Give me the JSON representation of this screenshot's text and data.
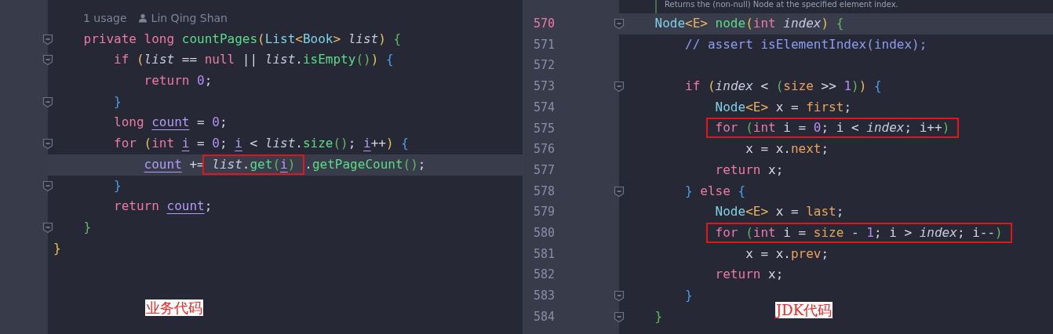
{
  "left": {
    "hint": {
      "usages": "1 usage",
      "author": "Lin Qing Shan"
    },
    "lines": [
      {
        "fold": true,
        "current": false,
        "tokens": [
          {
            "kind": "kw",
            "text": "    private "
          },
          {
            "kind": "kw",
            "text": "long "
          },
          {
            "kind": "fn",
            "text": "countPages"
          },
          {
            "kind": "b1",
            "text": "("
          },
          {
            "kind": "type",
            "text": "List"
          },
          {
            "kind": "gen",
            "text": "<"
          },
          {
            "kind": "type",
            "text": "Book"
          },
          {
            "kind": "gen",
            "text": "> "
          },
          {
            "kind": "param",
            "text": "list"
          },
          {
            "kind": "b1",
            "text": ") "
          },
          {
            "kind": "b2",
            "text": "{"
          }
        ]
      },
      {
        "fold": true,
        "current": false,
        "tokens": [
          {
            "kind": "kw",
            "text": "        if "
          },
          {
            "kind": "b1",
            "text": "("
          },
          {
            "kind": "param",
            "text": "list"
          },
          {
            "kind": "plain",
            "text": " == "
          },
          {
            "kind": "kw",
            "text": "null"
          },
          {
            "kind": "plain",
            "text": " || "
          },
          {
            "kind": "param",
            "text": "list"
          },
          {
            "kind": "plain",
            "text": "."
          },
          {
            "kind": "fn",
            "text": "isEmpty"
          },
          {
            "kind": "b2",
            "text": "()"
          },
          {
            "kind": "b1",
            "text": ") "
          },
          {
            "kind": "b3",
            "text": "{"
          }
        ]
      },
      {
        "fold": false,
        "current": false,
        "tokens": [
          {
            "kind": "kw",
            "text": "            return "
          },
          {
            "kind": "num",
            "text": "0"
          },
          {
            "kind": "plain",
            "text": ";"
          }
        ]
      },
      {
        "fold": true,
        "current": false,
        "tokens": [
          {
            "kind": "b3",
            "text": "        }"
          }
        ]
      },
      {
        "fold": false,
        "current": false,
        "tokens": [
          {
            "kind": "kw",
            "text": "        long "
          },
          {
            "kind": "local",
            "text": "count"
          },
          {
            "kind": "plain",
            "text": " = "
          },
          {
            "kind": "num",
            "text": "0"
          },
          {
            "kind": "plain",
            "text": ";"
          }
        ]
      },
      {
        "fold": true,
        "current": false,
        "tokens": [
          {
            "kind": "kw",
            "text": "        for "
          },
          {
            "kind": "b1",
            "text": "("
          },
          {
            "kind": "kw",
            "text": "int "
          },
          {
            "kind": "local",
            "text": "i"
          },
          {
            "kind": "plain",
            "text": " = "
          },
          {
            "kind": "num",
            "text": "0"
          },
          {
            "kind": "plain",
            "text": "; "
          },
          {
            "kind": "local",
            "text": "i"
          },
          {
            "kind": "plain",
            "text": " < "
          },
          {
            "kind": "param",
            "text": "list"
          },
          {
            "kind": "plain",
            "text": "."
          },
          {
            "kind": "fn",
            "text": "size"
          },
          {
            "kind": "b2",
            "text": "()"
          },
          {
            "kind": "plain",
            "text": "; "
          },
          {
            "kind": "local",
            "text": "i"
          },
          {
            "kind": "plain",
            "text": "++"
          },
          {
            "kind": "b1",
            "text": ") "
          },
          {
            "kind": "b3",
            "text": "{"
          }
        ]
      },
      {
        "fold": false,
        "current": true,
        "tokens": [
          {
            "kind": "local",
            "text": "            count"
          },
          {
            "kind": "plain",
            "text": " += "
          },
          {
            "kind": "box",
            "tokens": [
              {
                "kind": "param",
                "text": "list"
              },
              {
                "kind": "plain",
                "text": "."
              },
              {
                "kind": "fn",
                "text": "get"
              },
              {
                "kind": "b2",
                "text": "("
              },
              {
                "kind": "local",
                "text": "i"
              },
              {
                "kind": "b2",
                "text": ")"
              }
            ]
          },
          {
            "kind": "plain",
            "text": "."
          },
          {
            "kind": "fn",
            "text": "getPageCount"
          },
          {
            "kind": "b2",
            "text": "()"
          },
          {
            "kind": "plain",
            "text": ";"
          }
        ]
      },
      {
        "fold": true,
        "current": false,
        "tokens": [
          {
            "kind": "b3",
            "text": "        }"
          }
        ]
      },
      {
        "fold": false,
        "current": false,
        "tokens": [
          {
            "kind": "kw",
            "text": "        return "
          },
          {
            "kind": "local",
            "text": "count"
          },
          {
            "kind": "plain",
            "text": ";"
          }
        ]
      },
      {
        "fold": true,
        "current": false,
        "tokens": [
          {
            "kind": "b2",
            "text": "    }"
          }
        ]
      },
      {
        "fold": false,
        "current": false,
        "tokens": [
          {
            "kind": "b1",
            "text": "}"
          }
        ]
      }
    ],
    "annotation": "业务代码"
  },
  "right": {
    "doc": "Returns the (non-null) Node at the specified element index.",
    "lines": [
      {
        "number": "570",
        "fold": true,
        "current": true,
        "tokens": [
          {
            "kind": "type",
            "text": "    Node"
          },
          {
            "kind": "gen",
            "text": "<E> "
          },
          {
            "kind": "fn",
            "text": "node"
          },
          {
            "kind": "b1",
            "text": "("
          },
          {
            "kind": "kw",
            "text": "int "
          },
          {
            "kind": "param",
            "text": "index"
          },
          {
            "kind": "b1",
            "text": ") "
          },
          {
            "kind": "b2",
            "text": "{"
          }
        ]
      },
      {
        "number": "571",
        "fold": false,
        "current": false,
        "tokens": [
          {
            "kind": "comment",
            "text": "        // assert isElementIndex(index);"
          }
        ]
      },
      {
        "number": "572",
        "fold": false,
        "current": false
      },
      {
        "number": "573",
        "fold": true,
        "current": false,
        "tokens": [
          {
            "kind": "kw",
            "text": "        if "
          },
          {
            "kind": "b1",
            "text": "("
          },
          {
            "kind": "param",
            "text": "index"
          },
          {
            "kind": "plain",
            "text": " < "
          },
          {
            "kind": "b2",
            "text": "("
          },
          {
            "kind": "field",
            "text": "size"
          },
          {
            "kind": "plain",
            "text": " >> "
          },
          {
            "kind": "num",
            "text": "1"
          },
          {
            "kind": "b2",
            "text": ")"
          },
          {
            "kind": "b1",
            "text": ") "
          },
          {
            "kind": "b3",
            "text": "{"
          }
        ]
      },
      {
        "number": "574",
        "fold": false,
        "current": false,
        "tokens": [
          {
            "kind": "type",
            "text": "            Node"
          },
          {
            "kind": "gen",
            "text": "<E>"
          },
          {
            "kind": "plain",
            "text": " x = "
          },
          {
            "kind": "field",
            "text": "first"
          },
          {
            "kind": "plain",
            "text": ";"
          }
        ]
      },
      {
        "number": "575",
        "fold": false,
        "current": false,
        "tokens": [
          {
            "kind": "box",
            "tokens": [
              {
                "kind": "kw",
                "text": "            for "
              },
              {
                "kind": "b2",
                "text": "("
              },
              {
                "kind": "kw",
                "text": "int"
              },
              {
                "kind": "plain",
                "text": " i = "
              },
              {
                "kind": "num",
                "text": "0"
              },
              {
                "kind": "plain",
                "text": "; i < "
              },
              {
                "kind": "param",
                "text": "index"
              },
              {
                "kind": "plain",
                "text": "; i++"
              },
              {
                "kind": "b2",
                "text": ")"
              }
            ]
          }
        ]
      },
      {
        "number": "576",
        "fold": false,
        "current": false,
        "tokens": [
          {
            "kind": "plain",
            "text": "                x = x."
          },
          {
            "kind": "field",
            "text": "next"
          },
          {
            "kind": "plain",
            "text": ";"
          }
        ]
      },
      {
        "number": "577",
        "fold": false,
        "current": false,
        "tokens": [
          {
            "kind": "kw",
            "text": "            return"
          },
          {
            "kind": "plain",
            "text": " x;"
          }
        ]
      },
      {
        "number": "578",
        "fold": true,
        "current": false,
        "tokens": [
          {
            "kind": "b3",
            "text": "        } "
          },
          {
            "kind": "kw",
            "text": "else "
          },
          {
            "kind": "b3",
            "text": "{"
          }
        ]
      },
      {
        "number": "579",
        "fold": false,
        "current": false,
        "tokens": [
          {
            "kind": "type",
            "text": "            Node"
          },
          {
            "kind": "gen",
            "text": "<E>"
          },
          {
            "kind": "plain",
            "text": " x = "
          },
          {
            "kind": "field",
            "text": "last"
          },
          {
            "kind": "plain",
            "text": ";"
          }
        ]
      },
      {
        "number": "580",
        "fold": false,
        "current": false,
        "tokens": [
          {
            "kind": "box",
            "tokens": [
              {
                "kind": "kw",
                "text": "            for "
              },
              {
                "kind": "b2",
                "text": "("
              },
              {
                "kind": "kw",
                "text": "int"
              },
              {
                "kind": "plain",
                "text": " i = "
              },
              {
                "kind": "field",
                "text": "size"
              },
              {
                "kind": "plain",
                "text": " - "
              },
              {
                "kind": "num",
                "text": "1"
              },
              {
                "kind": "plain",
                "text": "; i > "
              },
              {
                "kind": "param",
                "text": "index"
              },
              {
                "kind": "plain",
                "text": "; i--"
              },
              {
                "kind": "b2",
                "text": ")"
              }
            ]
          }
        ]
      },
      {
        "number": "581",
        "fold": false,
        "current": false,
        "tokens": [
          {
            "kind": "plain",
            "text": "                x = x."
          },
          {
            "kind": "field",
            "text": "prev"
          },
          {
            "kind": "plain",
            "text": ";"
          }
        ]
      },
      {
        "number": "582",
        "fold": false,
        "current": false,
        "tokens": [
          {
            "kind": "kw",
            "text": "            return"
          },
          {
            "kind": "plain",
            "text": " x;"
          }
        ]
      },
      {
        "number": "583",
        "fold": true,
        "current": false,
        "tokens": [
          {
            "kind": "b3",
            "text": "        }"
          }
        ]
      },
      {
        "number": "584",
        "fold": true,
        "current": false,
        "tokens": [
          {
            "kind": "b2",
            "text": "    }"
          }
        ]
      }
    ],
    "annotation": "JDK代码"
  }
}
